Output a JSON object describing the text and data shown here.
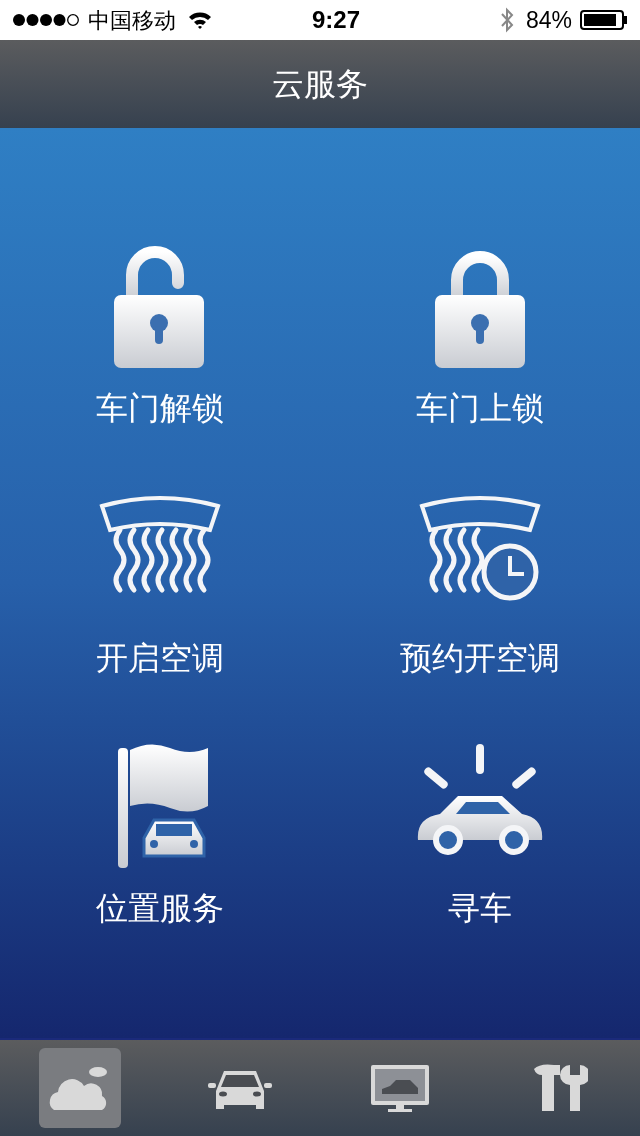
{
  "status_bar": {
    "carrier": "中国移动",
    "time": "9:27",
    "battery": "84%"
  },
  "title": "云服务",
  "services": [
    {
      "label": "车门解锁",
      "kind": "unlock"
    },
    {
      "label": "车门上锁",
      "kind": "lock"
    },
    {
      "label": "开启空调",
      "kind": "ac"
    },
    {
      "label": "预约开空调",
      "kind": "scheduled_ac"
    },
    {
      "label": "位置服务",
      "kind": "location"
    },
    {
      "label": "寻车",
      "kind": "find_car"
    }
  ],
  "tabs": [
    {
      "kind": "cloud",
      "selected": true
    },
    {
      "kind": "car",
      "selected": false
    },
    {
      "kind": "monitor",
      "selected": false
    },
    {
      "kind": "tools",
      "selected": false
    }
  ]
}
